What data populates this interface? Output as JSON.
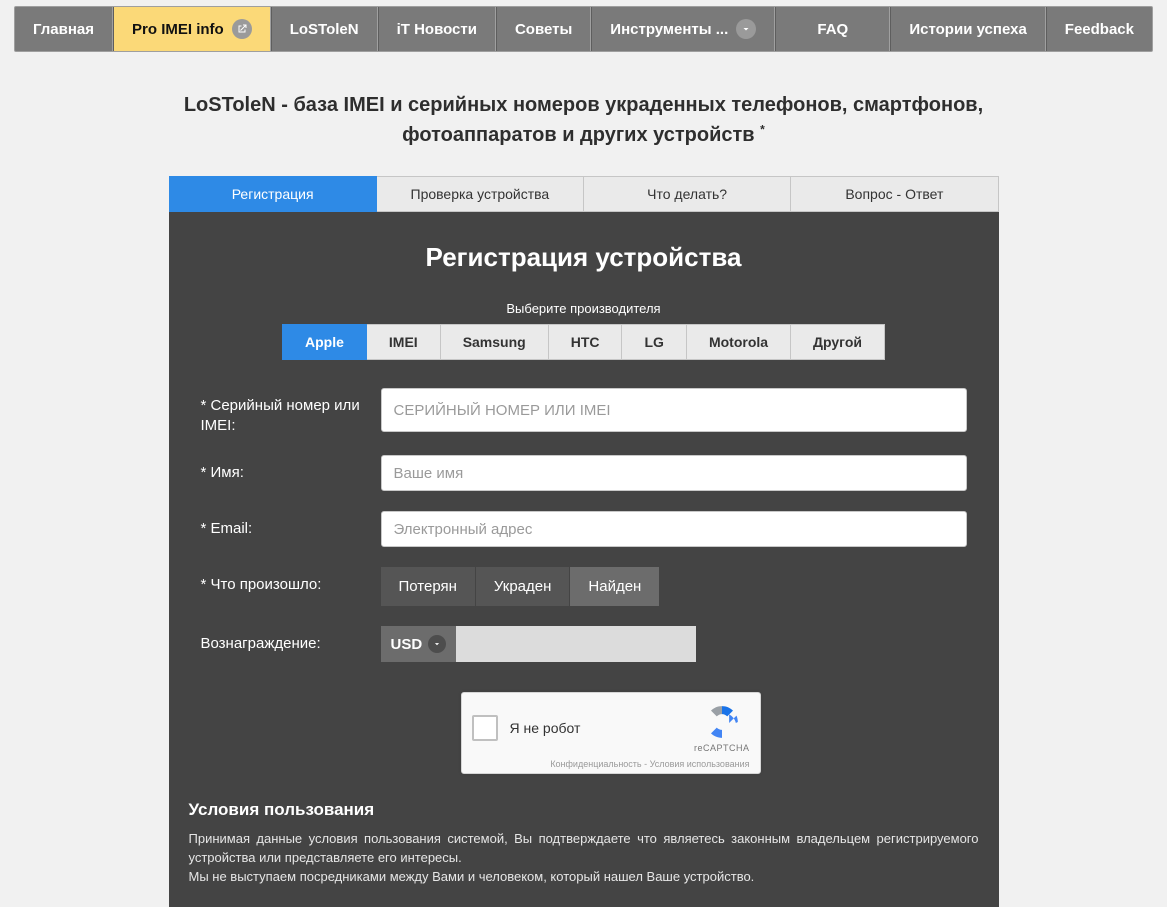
{
  "nav": {
    "items": [
      {
        "label": "Главная",
        "icon": null
      },
      {
        "label": "Pro IMEI info",
        "icon": "external-link-icon",
        "active": true
      },
      {
        "label": "LoSToleN",
        "icon": null
      },
      {
        "label": "iT Новости",
        "icon": null
      },
      {
        "label": "Советы",
        "icon": null
      },
      {
        "label": "Инструменты ...",
        "icon": "chevron-down-icon"
      },
      {
        "label": "FAQ",
        "icon": null
      },
      {
        "label": "Истории успеха",
        "icon": null
      },
      {
        "label": "Feedback",
        "icon": null
      }
    ]
  },
  "page_title": "LoSToleN - база IMEI и серийных номеров украденных телефонов, смартфонов, фотоаппаратов и других устройств",
  "page_title_sup": "*",
  "tabs": [
    {
      "label": "Регистрация",
      "active": true
    },
    {
      "label": "Проверка устройства"
    },
    {
      "label": "Что делать?"
    },
    {
      "label": "Вопрос - Ответ"
    }
  ],
  "panel_heading": "Регистрация устройства",
  "choose_label": "Выберите производителя",
  "brands": [
    {
      "label": "Apple",
      "active": true
    },
    {
      "label": "IMEI"
    },
    {
      "label": "Samsung"
    },
    {
      "label": "HTC"
    },
    {
      "label": "LG"
    },
    {
      "label": "Motorola"
    },
    {
      "label": "Другой"
    }
  ],
  "form": {
    "serial_label": "* Серийный номер или IMEI:",
    "serial_placeholder": "СЕРИЙНЫЙ НОМЕР ИЛИ IMEI",
    "name_label": "* Имя:",
    "name_placeholder": "Ваше имя",
    "email_label": "* Email:",
    "email_placeholder": "Электронный адрес",
    "status_label": "* Что произошло:",
    "status_options": [
      "Потерян",
      "Украден",
      "Найден"
    ],
    "reward_label": "Вознаграждение:",
    "currency": "USD"
  },
  "captcha": {
    "label": "Я не робот",
    "brand": "reCAPTCHA",
    "terms": "Конфиденциальность - Условия использования"
  },
  "terms": {
    "heading": "Условия пользования",
    "p1": "Принимая данные условия пользования системой, Вы подтверждаете что являетесь законным владельцем регистрируемого устройства или представляете его интересы.",
    "p2": "Мы не выступаем посредниками между Вами и человеком, который нашел Ваше устройство."
  }
}
